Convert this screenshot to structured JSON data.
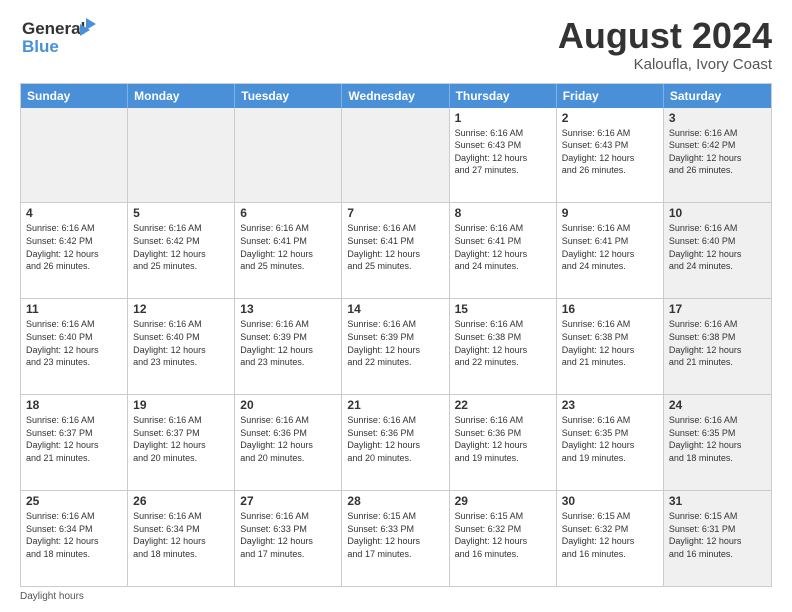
{
  "logo": {
    "line1": "General",
    "line2": "Blue"
  },
  "title": "August 2024",
  "subtitle": "Kaloufla, Ivory Coast",
  "weekdays": [
    "Sunday",
    "Monday",
    "Tuesday",
    "Wednesday",
    "Thursday",
    "Friday",
    "Saturday"
  ],
  "footer": "Daylight hours",
  "weeks": [
    [
      {
        "day": "",
        "info": "",
        "shaded": true
      },
      {
        "day": "",
        "info": "",
        "shaded": true
      },
      {
        "day": "",
        "info": "",
        "shaded": true
      },
      {
        "day": "",
        "info": "",
        "shaded": true
      },
      {
        "day": "1",
        "info": "Sunrise: 6:16 AM\nSunset: 6:43 PM\nDaylight: 12 hours\nand 27 minutes."
      },
      {
        "day": "2",
        "info": "Sunrise: 6:16 AM\nSunset: 6:43 PM\nDaylight: 12 hours\nand 26 minutes."
      },
      {
        "day": "3",
        "info": "Sunrise: 6:16 AM\nSunset: 6:42 PM\nDaylight: 12 hours\nand 26 minutes.",
        "shaded": true
      }
    ],
    [
      {
        "day": "4",
        "info": "Sunrise: 6:16 AM\nSunset: 6:42 PM\nDaylight: 12 hours\nand 26 minutes."
      },
      {
        "day": "5",
        "info": "Sunrise: 6:16 AM\nSunset: 6:42 PM\nDaylight: 12 hours\nand 25 minutes."
      },
      {
        "day": "6",
        "info": "Sunrise: 6:16 AM\nSunset: 6:41 PM\nDaylight: 12 hours\nand 25 minutes."
      },
      {
        "day": "7",
        "info": "Sunrise: 6:16 AM\nSunset: 6:41 PM\nDaylight: 12 hours\nand 25 minutes."
      },
      {
        "day": "8",
        "info": "Sunrise: 6:16 AM\nSunset: 6:41 PM\nDaylight: 12 hours\nand 24 minutes."
      },
      {
        "day": "9",
        "info": "Sunrise: 6:16 AM\nSunset: 6:41 PM\nDaylight: 12 hours\nand 24 minutes."
      },
      {
        "day": "10",
        "info": "Sunrise: 6:16 AM\nSunset: 6:40 PM\nDaylight: 12 hours\nand 24 minutes.",
        "shaded": true
      }
    ],
    [
      {
        "day": "11",
        "info": "Sunrise: 6:16 AM\nSunset: 6:40 PM\nDaylight: 12 hours\nand 23 minutes."
      },
      {
        "day": "12",
        "info": "Sunrise: 6:16 AM\nSunset: 6:40 PM\nDaylight: 12 hours\nand 23 minutes."
      },
      {
        "day": "13",
        "info": "Sunrise: 6:16 AM\nSunset: 6:39 PM\nDaylight: 12 hours\nand 23 minutes."
      },
      {
        "day": "14",
        "info": "Sunrise: 6:16 AM\nSunset: 6:39 PM\nDaylight: 12 hours\nand 22 minutes."
      },
      {
        "day": "15",
        "info": "Sunrise: 6:16 AM\nSunset: 6:38 PM\nDaylight: 12 hours\nand 22 minutes."
      },
      {
        "day": "16",
        "info": "Sunrise: 6:16 AM\nSunset: 6:38 PM\nDaylight: 12 hours\nand 21 minutes."
      },
      {
        "day": "17",
        "info": "Sunrise: 6:16 AM\nSunset: 6:38 PM\nDaylight: 12 hours\nand 21 minutes.",
        "shaded": true
      }
    ],
    [
      {
        "day": "18",
        "info": "Sunrise: 6:16 AM\nSunset: 6:37 PM\nDaylight: 12 hours\nand 21 minutes."
      },
      {
        "day": "19",
        "info": "Sunrise: 6:16 AM\nSunset: 6:37 PM\nDaylight: 12 hours\nand 20 minutes."
      },
      {
        "day": "20",
        "info": "Sunrise: 6:16 AM\nSunset: 6:36 PM\nDaylight: 12 hours\nand 20 minutes."
      },
      {
        "day": "21",
        "info": "Sunrise: 6:16 AM\nSunset: 6:36 PM\nDaylight: 12 hours\nand 20 minutes."
      },
      {
        "day": "22",
        "info": "Sunrise: 6:16 AM\nSunset: 6:36 PM\nDaylight: 12 hours\nand 19 minutes."
      },
      {
        "day": "23",
        "info": "Sunrise: 6:16 AM\nSunset: 6:35 PM\nDaylight: 12 hours\nand 19 minutes."
      },
      {
        "day": "24",
        "info": "Sunrise: 6:16 AM\nSunset: 6:35 PM\nDaylight: 12 hours\nand 18 minutes.",
        "shaded": true
      }
    ],
    [
      {
        "day": "25",
        "info": "Sunrise: 6:16 AM\nSunset: 6:34 PM\nDaylight: 12 hours\nand 18 minutes."
      },
      {
        "day": "26",
        "info": "Sunrise: 6:16 AM\nSunset: 6:34 PM\nDaylight: 12 hours\nand 18 minutes."
      },
      {
        "day": "27",
        "info": "Sunrise: 6:16 AM\nSunset: 6:33 PM\nDaylight: 12 hours\nand 17 minutes."
      },
      {
        "day": "28",
        "info": "Sunrise: 6:15 AM\nSunset: 6:33 PM\nDaylight: 12 hours\nand 17 minutes."
      },
      {
        "day": "29",
        "info": "Sunrise: 6:15 AM\nSunset: 6:32 PM\nDaylight: 12 hours\nand 16 minutes."
      },
      {
        "day": "30",
        "info": "Sunrise: 6:15 AM\nSunset: 6:32 PM\nDaylight: 12 hours\nand 16 minutes."
      },
      {
        "day": "31",
        "info": "Sunrise: 6:15 AM\nSunset: 6:31 PM\nDaylight: 12 hours\nand 16 minutes.",
        "shaded": true
      }
    ]
  ]
}
